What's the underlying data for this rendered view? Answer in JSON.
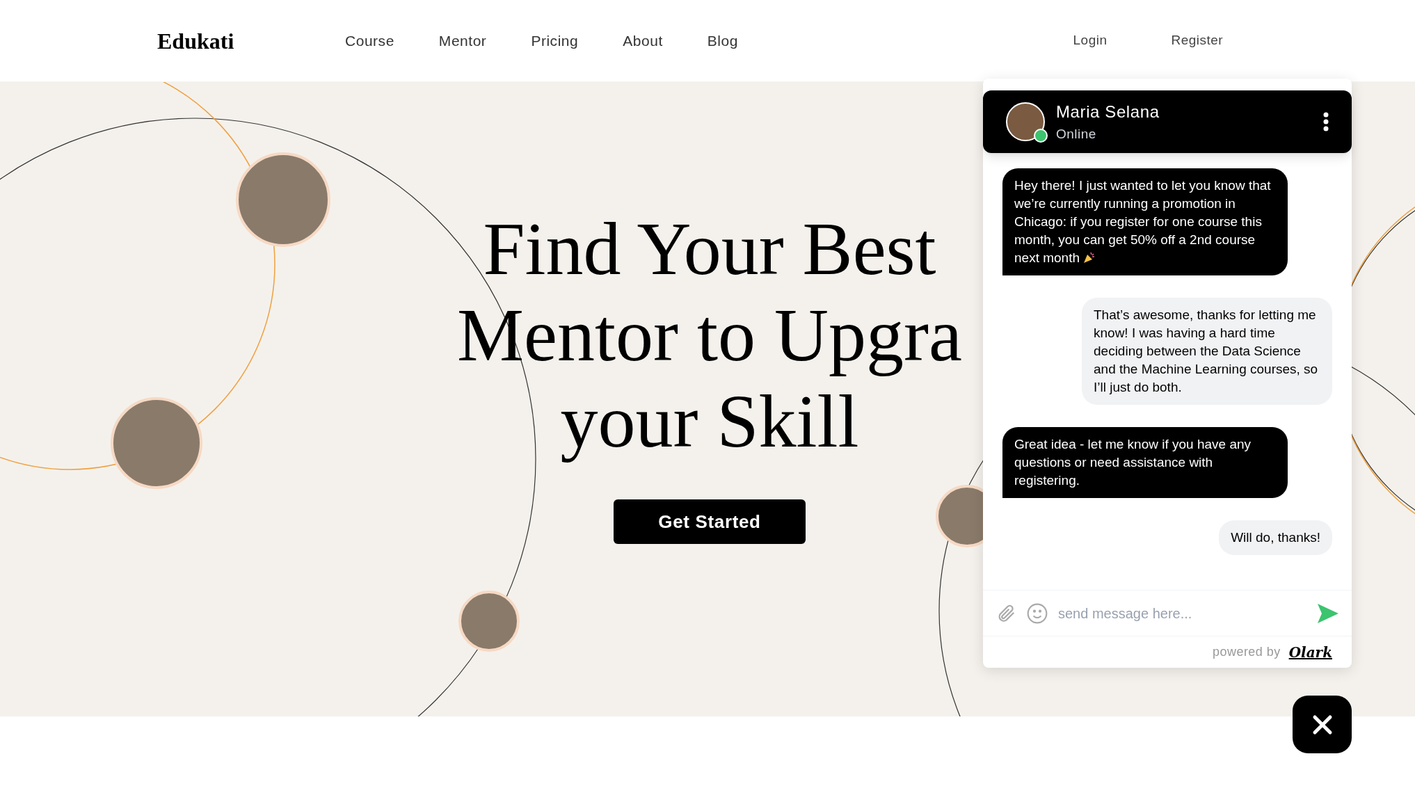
{
  "header": {
    "logo": "Edukati",
    "nav": [
      "Course",
      "Mentor",
      "Pricing",
      "About",
      "Blog"
    ],
    "auth": [
      "Login",
      "Register"
    ]
  },
  "hero": {
    "headline": [
      "Find Your Best",
      "Mentor to Upgra",
      "your Skill"
    ],
    "cta": "Get Started"
  },
  "chat": {
    "agent": {
      "name": "Maria Selana",
      "status": "Online",
      "online": true
    },
    "messages": [
      {
        "kind": "agent",
        "text": "Hey there! I just wanted to let you know that we’re currently running a promotion in Chicago: if you register for one course this month, you can get 50% off a 2nd course next month",
        "emoji": true
      },
      {
        "kind": "visitor",
        "text": "That’s awesome, thanks for letting me know! I was having a hard time deciding between the Data Science and the Machine Learning courses, so I’ll just do both."
      },
      {
        "kind": "agent",
        "text": "Great idea - let me know if you have any questions or need assistance with registering."
      },
      {
        "kind": "visitor",
        "text": "Will do, thanks!"
      }
    ],
    "input": {
      "placeholder": "send message here..."
    },
    "footer": {
      "powered_by": "powered by",
      "brand": "Olark"
    }
  }
}
